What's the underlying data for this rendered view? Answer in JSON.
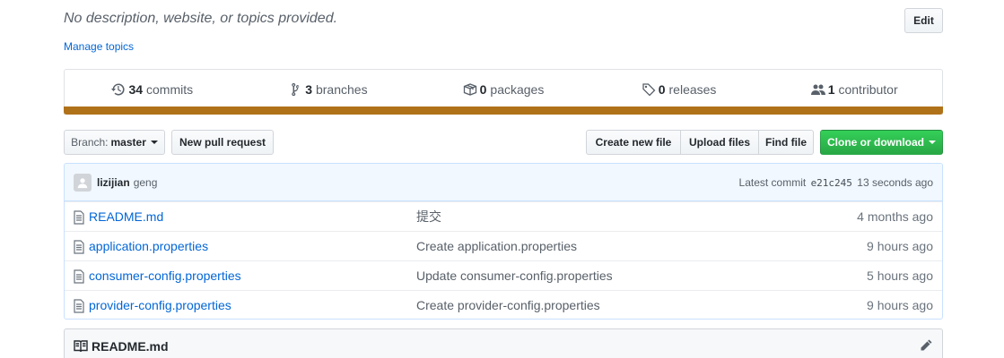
{
  "repo": {
    "description": "No description, website, or topics provided.",
    "edit_label": "Edit",
    "manage_topics": "Manage topics"
  },
  "summary": {
    "commits": {
      "count": "34",
      "label": "commits",
      "icon": "history-icon"
    },
    "branches": {
      "count": "3",
      "label": "branches",
      "icon": "git-branch-icon"
    },
    "packages": {
      "count": "0",
      "label": "packages",
      "icon": "package-icon"
    },
    "releases": {
      "count": "0",
      "label": "releases",
      "icon": "tag-icon"
    },
    "contributors": {
      "count": "1",
      "label": "contributor",
      "icon": "people-icon"
    }
  },
  "language_bar": {
    "color": "#b07219",
    "percent": 100
  },
  "toolbar": {
    "branch_label": "Branch:",
    "branch_value": "master",
    "new_pr": "New pull request",
    "create_file": "Create new file",
    "upload_files": "Upload files",
    "find_file": "Find file",
    "clone": "Clone or download"
  },
  "latest_commit": {
    "author": "lizijian",
    "message": "geng",
    "prefix": "Latest commit",
    "sha": "e21c245",
    "age": "13 seconds ago"
  },
  "files": [
    {
      "name": "README.md",
      "message": "提交",
      "age": "4 months ago"
    },
    {
      "name": "application.properties",
      "message": "Create application.properties",
      "age": "9 hours ago"
    },
    {
      "name": "consumer-config.properties",
      "message": "Update consumer-config.properties",
      "age": "5 hours ago"
    },
    {
      "name": "provider-config.properties",
      "message": "Create provider-config.properties",
      "age": "9 hours ago"
    }
  ],
  "readme": {
    "title": "README.md"
  },
  "colors": {
    "link": "#0366d6",
    "green": "#28a745",
    "java": "#b07219"
  }
}
